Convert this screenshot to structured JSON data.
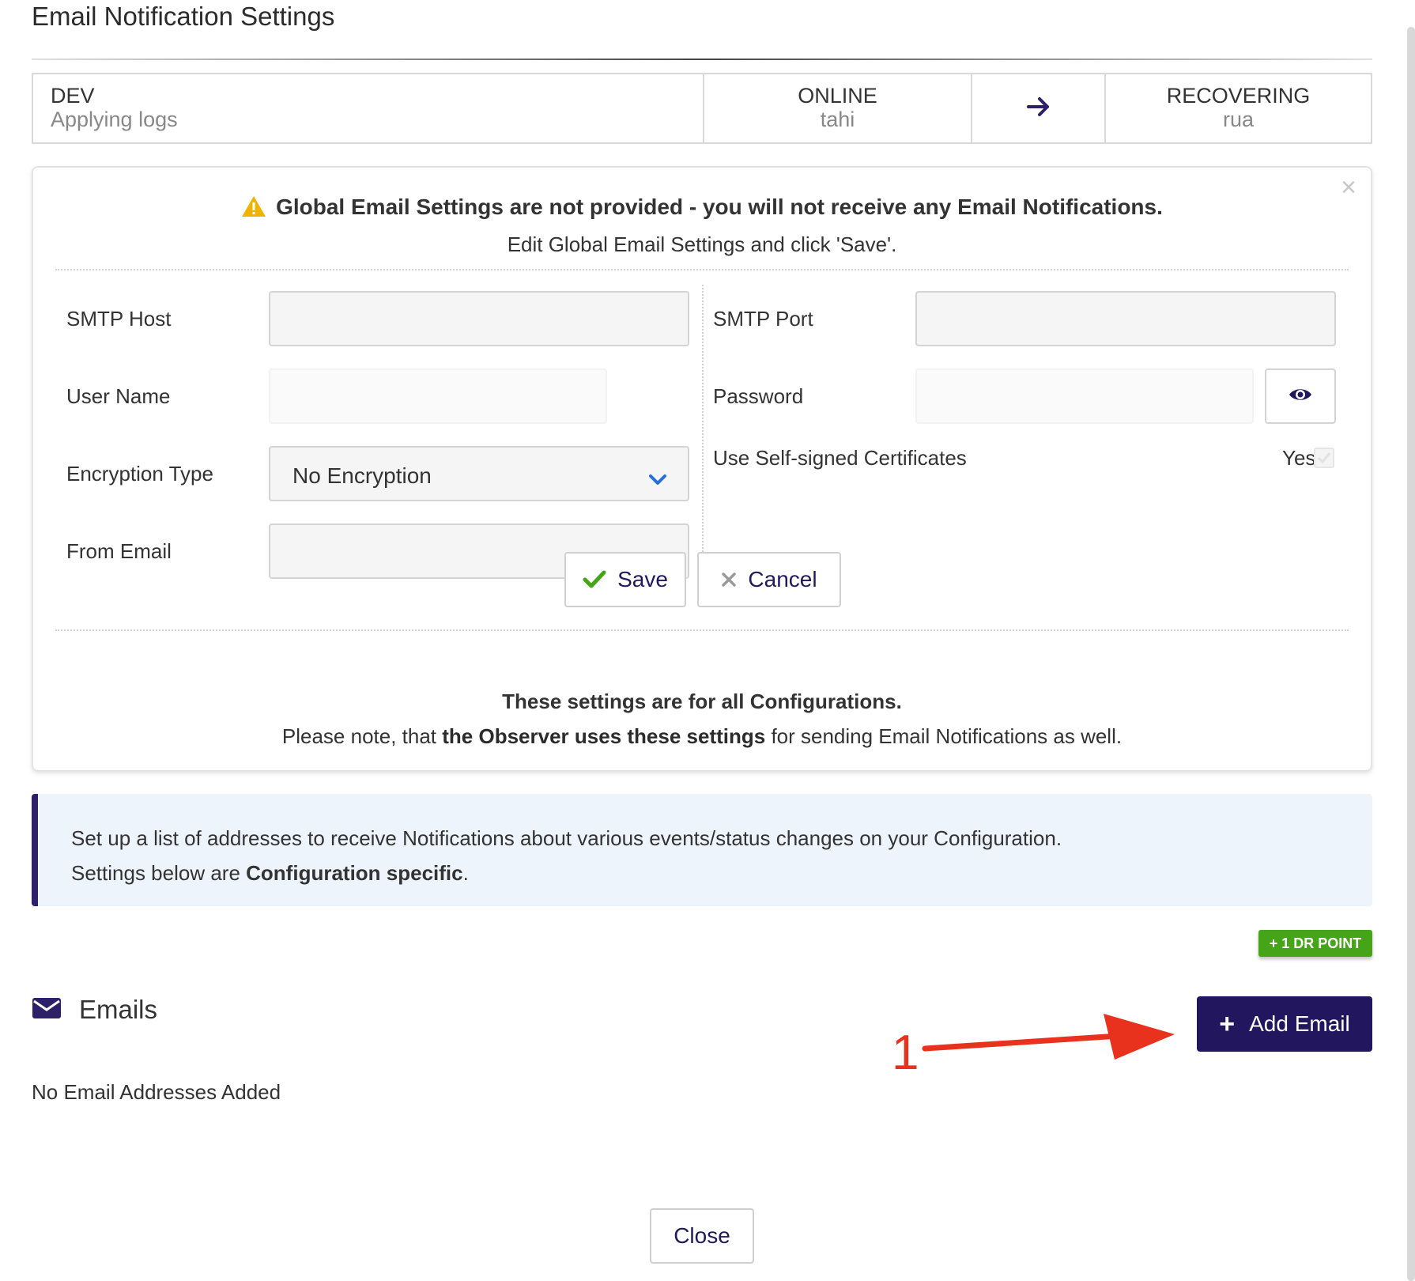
{
  "title": "Email Notification Settings",
  "status_bar": {
    "source": {
      "name": "DEV",
      "state": "Applying logs"
    },
    "online": {
      "label": "ONLINE",
      "host": "tahi"
    },
    "arrow_icon": "arrow-right-icon",
    "target": {
      "label": "RECOVERING",
      "host": "rua"
    }
  },
  "global_settings": {
    "warning_title": "Global Email Settings are not provided - you will not receive any Email Notifications.",
    "warning_subtitle": "Edit Global Email Settings and click 'Save'.",
    "fields": {
      "smtp_host": {
        "label": "SMTP Host",
        "value": ""
      },
      "smtp_port": {
        "label": "SMTP Port",
        "value": ""
      },
      "user_name": {
        "label": "User Name",
        "value": ""
      },
      "password": {
        "label": "Password",
        "value": ""
      },
      "encryption_type": {
        "label": "Encryption Type",
        "value": "No Encryption"
      },
      "self_signed": {
        "label": "Use Self-signed Certificates",
        "value_label": "Yes",
        "checked": true
      },
      "from_email": {
        "label": "From Email",
        "value": ""
      }
    },
    "save_label": "Save",
    "cancel_label": "Cancel",
    "note_line1": "These settings are for all Configurations.",
    "note_line2_pre": "Please note, that ",
    "note_line2_bold": "the Observer uses these settings",
    "note_line2_post": " for sending Email Notifications as well."
  },
  "info": {
    "line1": "Set up a list of addresses to receive Notifications about various events/status changes on your Configuration.",
    "line2_pre": "Settings below are ",
    "line2_bold": "Configuration specific",
    "line2_post": "."
  },
  "badge": "+ 1 DR POINT",
  "emails": {
    "title": "Emails",
    "add_label": "Add Email",
    "empty_text": "No Email Addresses Added"
  },
  "annotation": {
    "number": "1"
  },
  "close_label": "Close",
  "colors": {
    "primary": "#22175f",
    "warning": "#f0b400",
    "success": "#46a418",
    "annotation": "#e8321d",
    "info_bg": "#eef4fb"
  }
}
